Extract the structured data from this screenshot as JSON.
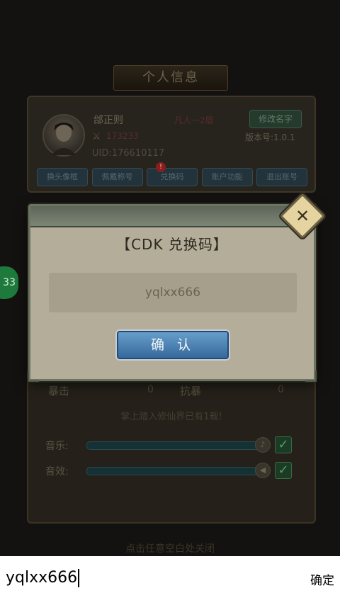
{
  "background": {
    "title": "个人信息",
    "player_name": "邰正则",
    "realm": "凡人一2层",
    "rename_button": "修改名字",
    "power_value": "173233",
    "version": "版本号:1.0.1",
    "uid": "UID:176610117",
    "tabs": [
      "换头像框",
      "佩戴称号",
      "兑换码",
      "账户功能",
      "退出账号"
    ],
    "alert_badge": "!",
    "side_chip": "33",
    "stats": {
      "crit_label": "暴击",
      "crit_value": "0",
      "resist_label": "抗暴",
      "resist_value": "0"
    },
    "note": "掌上踏入修仙界已有1载!",
    "music_label": "音乐:",
    "sfx_label": "音效:",
    "close_hint": "点击任意空白处关闭"
  },
  "dialog": {
    "title": "【CDK 兑换码】",
    "input_value": "yqlxx666",
    "confirm_label": "确 认",
    "close_glyph": "✕"
  },
  "ime": {
    "text": "yqlxx666",
    "confirm_label": "确定"
  }
}
